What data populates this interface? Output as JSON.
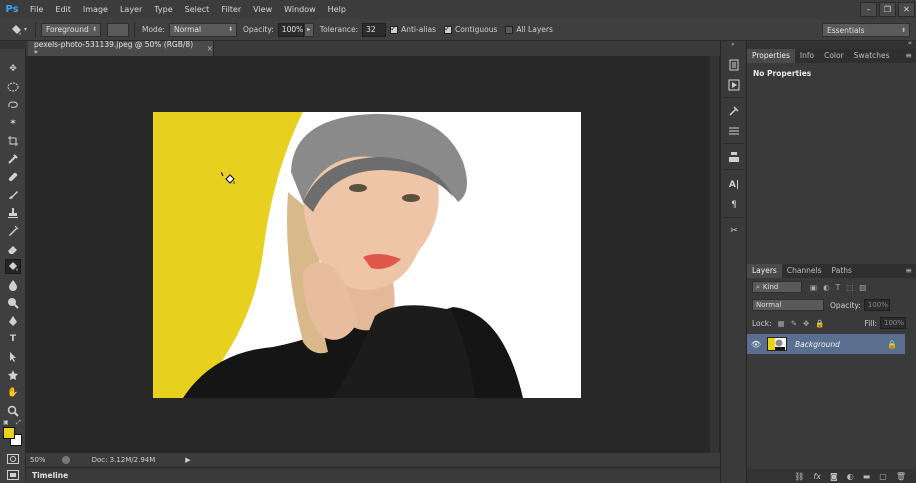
{
  "app": {
    "logo": "Ps"
  },
  "menu": [
    "File",
    "Edit",
    "Image",
    "Layer",
    "Type",
    "Select",
    "Filter",
    "View",
    "Window",
    "Help"
  ],
  "window_controls": {
    "minimize": "–",
    "restore": "❐",
    "close": "✕"
  },
  "options": {
    "fill_source": "Foreground",
    "pattern": "",
    "mode_label": "Mode:",
    "mode": "Normal",
    "opacity_label": "Opacity:",
    "opacity": "100%",
    "tolerance_label": "Tolerance:",
    "tolerance": "32",
    "antialias_label": "Anti-alias",
    "antialias": true,
    "contiguous_label": "Contiguous",
    "contiguous": true,
    "all_layers_label": "All Layers",
    "all_layers": false,
    "workspace": "Essentials"
  },
  "document": {
    "tab_title": "pexels-photo-531139.jpeg @ 50% (RGB/8) *",
    "close": "×"
  },
  "status": {
    "zoom": "50%",
    "doc_info": "Doc: 3.12M/2.94M"
  },
  "timeline": {
    "label": "Timeline"
  },
  "colors": {
    "foreground": "#e9d31a",
    "background": "#ffffff",
    "selected_layer": "#5a6e8f"
  },
  "properties_panel": {
    "tabs": [
      "Properties",
      "Info",
      "Color",
      "Swatches"
    ],
    "body": "No Properties"
  },
  "layers_panel": {
    "tabs": [
      "Layers",
      "Channels",
      "Paths"
    ],
    "kind": "Kind",
    "blend_mode": "Normal",
    "opacity_label": "Opacity:",
    "opacity": "100%",
    "lock_label": "Lock:",
    "fill_label": "Fill:",
    "fill": "100%",
    "layers": [
      {
        "name": "Background",
        "visible": true,
        "locked": true
      }
    ]
  },
  "tools": [
    "move-tool",
    "marquee-tool",
    "lasso-tool",
    "magic-wand-tool",
    "crop-tool",
    "eyedropper-tool",
    "healing-brush-tool",
    "brush-tool",
    "clone-stamp-tool",
    "history-brush-tool",
    "eraser-tool",
    "paint-bucket-tool",
    "blur-tool",
    "dodge-tool",
    "pen-tool",
    "type-tool",
    "path-selection-tool",
    "shape-tool",
    "hand-tool",
    "zoom-tool"
  ]
}
